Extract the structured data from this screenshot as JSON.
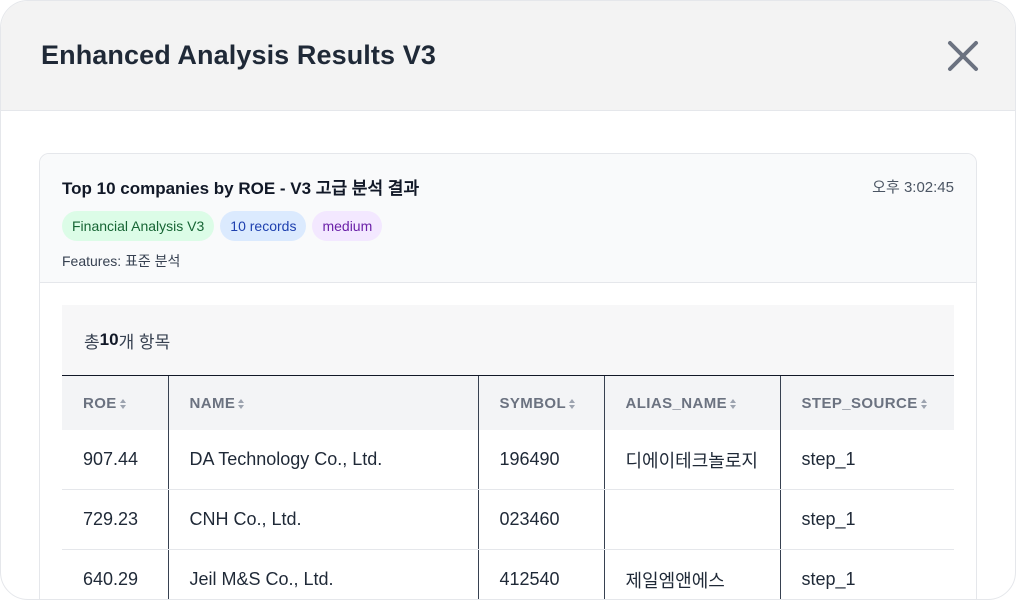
{
  "modal": {
    "title": "Enhanced Analysis Results V3"
  },
  "result": {
    "query": "Top 10 companies by ROE - V3 고급 분석 결과",
    "timestamp": "오후 3:02:45",
    "badges": [
      "Financial Analysis V3",
      "10 records",
      "medium"
    ],
    "features": "Features: 표준 분석",
    "summary": {
      "prefix": "총 ",
      "count": "10",
      "suffix": "개 항목"
    }
  },
  "table": {
    "columns": [
      "ROE",
      "NAME",
      "SYMBOL",
      "ALIAS_NAME",
      "STEP_SOURCE"
    ],
    "rows": [
      [
        "907.44",
        "DA Technology Co., Ltd.",
        "196490",
        "디에이테크놀로지",
        "step_1"
      ],
      [
        "729.23",
        "CNH Co., Ltd.",
        "023460",
        "",
        "step_1"
      ],
      [
        "640.29",
        "Jeil M&S Co., Ltd.",
        "412540",
        "제일엠앤에스",
        "step_1"
      ]
    ]
  },
  "icons": {
    "close": "close-icon",
    "sort": "sort-icon"
  },
  "colors": {
    "header_bg": "#f3f3f3",
    "badge_green": "#dcfce7",
    "badge_blue": "#dbeafe",
    "badge_purple": "#f3e8ff"
  }
}
